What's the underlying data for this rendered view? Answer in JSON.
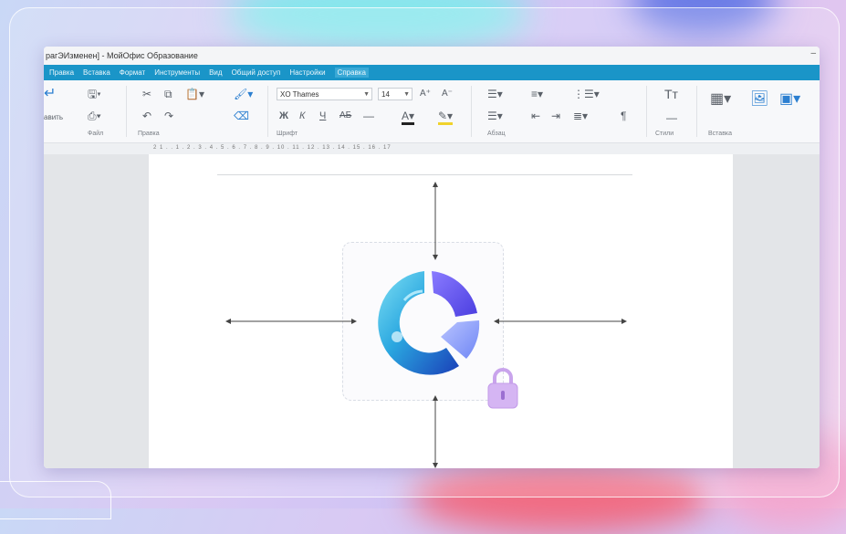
{
  "window": {
    "title": "рагЭИзменен] - МойОфис Образование",
    "minimize": "–"
  },
  "menu": [
    "Правка",
    "Вставка",
    "Формат",
    "Инструменты",
    "Вид",
    "Общий доступ",
    "Настройки",
    "Справка"
  ],
  "ribbon": {
    "paste_label": "авить",
    "font_name": "XO Thames",
    "font_size": "14",
    "groups": [
      "Файл",
      "Правка",
      "Шрифт",
      "Абзац",
      "Стили",
      "Вставка"
    ]
  },
  "ruler_numbers": "2 1 . . 1 . 2 . 3 . 4 . 5 . 6 . 7 . 8 . 9 . 10 . 11 . 12 . 13 . 14 . 15 . 16 . 17",
  "colors": {
    "menu_blue": "#1a95c8",
    "logo_blue": "#2aa7e0",
    "logo_violet": "#6a5ef0",
    "lock_purple": "#c9a4ec"
  },
  "icons": {
    "logo": "myoffice-logo-ring",
    "lock": "lock-icon"
  }
}
